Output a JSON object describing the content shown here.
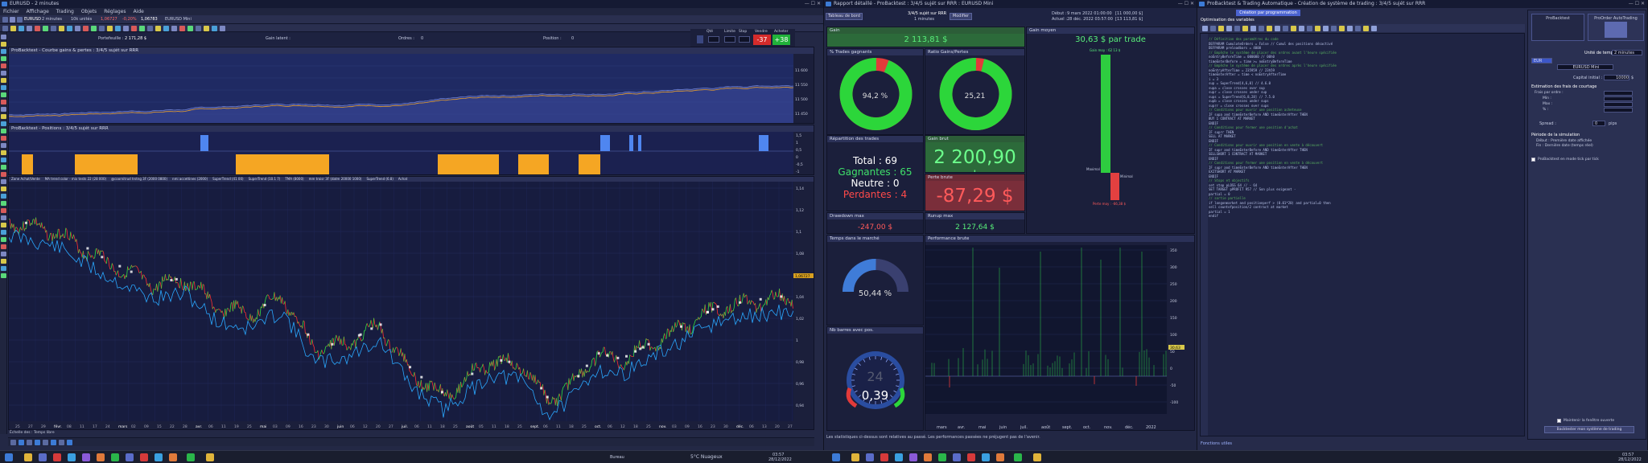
{
  "left_window": {
    "title": "EURUSD - 2 minutes",
    "menu": [
      "Fichier",
      "Affichage",
      "Trading",
      "Objets",
      "Réglages",
      "Aide"
    ],
    "toolbar_instrument": "EURUSD",
    "toolbar_timeframe": "2 minutes",
    "toolbar_units": "10k unités",
    "toolbar_quote": "1,06727",
    "toolbar_change": "-0,20%",
    "toolbar_price": "1,06783",
    "toolbar_instr2": "EURUSD Mini",
    "stats": {
      "portfolio_label": "Portefeuille :",
      "portfolio": "2 171,28 $",
      "gain_label": "Gain latent :",
      "orders_label": "Ordres :",
      "orders": "0",
      "position_label": "Position :",
      "position": "0"
    },
    "sell_label": "Vendre",
    "buy_label": "Acheter",
    "sell_value": "-37",
    "buy_value": "+38",
    "qty_label": "Qté",
    "limit_label": "Limite",
    "stop_label": "Stop",
    "equity_panel_title": "ProBacktest - Courbe gains & pertes : 3/4/5 sujét sur RRR",
    "positions_panel_title": "ProBacktest - Positions : 3/4/5 sujét sur RRR",
    "price_panel_title": "EURUSD Prix",
    "indicator_legend": [
      "Zone Achat/Vente",
      "MA trend color - mix tests 22 (28 000)",
      "@coornitrud trstng 3F (2000 0800)",
      "nmi accettines (2000)",
      "SuperTrend (41 00)",
      "SuperTrend (10.1 7)",
      "TMA (8000)",
      "mm troisr 3F (datm 20000 1000)",
      "SuperTrend (6.8)",
      "Achat"
    ],
    "equity_yaxis": [
      "11 600",
      "11 550",
      "11 500",
      "11 450"
    ],
    "position_yaxis": [
      "1,5",
      "1",
      "0,5",
      "0",
      "-0,5",
      "-1"
    ],
    "price_yaxis": [
      "1,14",
      "1,12",
      "1,1",
      "1,08",
      "1,06",
      "1,04",
      "1,02",
      "1",
      "0,98",
      "0,96",
      "0,94"
    ],
    "current_price_tag": "1,06727",
    "xaxis": [
      "25",
      "27",
      "29",
      "févr.",
      "08",
      "11",
      "17",
      "24",
      "mars",
      "02",
      "09",
      "15",
      "22",
      "28",
      "avr.",
      "06",
      "11",
      "19",
      "25",
      "mai",
      "03",
      "09",
      "16",
      "23",
      "30",
      "juin",
      "06",
      "12",
      "20",
      "27",
      "juil.",
      "06",
      "11",
      "18",
      "25",
      "août",
      "05",
      "11",
      "18",
      "25",
      "sept.",
      "06",
      "11",
      "18",
      "25",
      "oct.",
      "06",
      "12",
      "18",
      "25",
      "nov.",
      "03",
      "09",
      "16",
      "23",
      "30",
      "déc.",
      "06",
      "13",
      "20",
      "27"
    ],
    "footer": "Échelle des : Temps libre"
  },
  "report_window": {
    "title": "Rapport détaillé - ProBacktest : 3/4/5 sujét sur RRR : EURUSD Mini",
    "tabs": [
      "Tableau de bord",
      "Modifier"
    ],
    "system_name": "3/4/5 sujét sur RRR",
    "timeframe": "1 minutes",
    "debut_label": "Début :",
    "debut": "9 mars 2022 01:00:00",
    "debut_capital": "[11 000,00 $]",
    "actuel_label": "Actuel :",
    "actuel": "28 déc. 2022 03:57:00",
    "actuel_capital": "[13 113,81 $]",
    "gain": {
      "title": "Gain",
      "value": "2 113,81 $"
    },
    "gain_moyen": {
      "title": "Gain moyen",
      "value": "30,63 $ par trade",
      "gain_label": "Gain moy : 62 13 $",
      "loss_label": "Perte moy : -66,38 $",
      "max_label": "Maximal",
      "min_label": "Minimal"
    },
    "pct_gagnants": {
      "title": "% Trades gagnants",
      "value": "94,2 %",
      "pct": 94.2
    },
    "ratio": {
      "title": "Ratio Gains/Pertes",
      "value": "25,21",
      "pct": 96.2
    },
    "repartition": {
      "title": "Répartition des trades",
      "total_label": "Total :",
      "total": "69",
      "gagnantes_label": "Gagnantes :",
      "gagnantes": "65",
      "neutre_label": "Neutre :",
      "neutre": "0",
      "perdantes_label": "Perdantes :",
      "perdantes": "4"
    },
    "gain_brut": {
      "title": "Gain brut",
      "value": "2 200,90 $"
    },
    "perte_brute": {
      "title": "Perte brute",
      "value": "-87,29 $"
    },
    "drawdown": {
      "title": "Drawdown max",
      "value": "-247,00 $"
    },
    "runup": {
      "title": "Runup max",
      "value": "2 127,64 $"
    },
    "temps_marche": {
      "title": "Temps dans le marché",
      "value": "50,44 %",
      "pct": 50.44
    },
    "barres": {
      "title": "Nb barres avec pos.",
      "value": "0,39",
      "small": "24"
    },
    "perf": {
      "title": "Performance brute",
      "yaxis": [
        "350",
        "300",
        "250",
        "200",
        "150",
        "100",
        "50",
        "0",
        "-50",
        "-100"
      ],
      "xaxis": [
        "mars",
        "avr.",
        "mai",
        "juin",
        "juil.",
        "août",
        "sept.",
        "oct.",
        "nov.",
        "déc.",
        "2022"
      ],
      "tag": "30,63"
    },
    "footer": "Les statistiques ci-dessus sont relatives au passé. Les performances passées ne préjugent pas de l'avenir."
  },
  "editor_window": {
    "title": "ProBacktest & Trading Automatique - Création de système de trading : 3/4/5 sujét sur RRR",
    "tab": "Création par programmation",
    "vars_label": "Optimisation des variables",
    "footer_link": "Fonctions utiles",
    "code": [
      "// Définition des paramètres du code",
      "DEFPARAM CumulateOrders = False // Cumul des positions désactivé",
      "DEFPARAM preloadbars = 4000",
      "",
      "// Empêche le système de placer des ordres avant l'heure spécifiée",
      "noEntryBeforeTime = 000000 // 00h0",
      "timeEnterBefore = time >= noEntryBeforeTime",
      "// Empêche le système de placer des ordres après l'heure spécifiée",
      "noEntryAfterTime = 235959 // 23h59",
      "timeEnterAfter = time < noEntryAfterTime",
      "",
      "i = 3",
      "",
      "sup = SuperTrend[4,6,0] // 4.6.0",
      "supa = close crosses over sup",
      "supr = close crosses under sup",
      "",
      "sups = SuperTrend[6,8,28] // 7.5.0",
      "supb = close crosses under sups",
      "suprr = close crosses over sups",
      "",
      "",
      "// Conditions pour ouvrir une position acheteuse",
      "IF supa and timeEnterBefore AND timeEnterAfter THEN",
      "  BUY 1 CONTRACT AT MARKET",
      "ENDIF",
      "",
      "// Conditions pour fermer une position d'achat",
      "IF suprr THEN",
      "  SELL AT MARKET",
      "ENDIF",
      "",
      "// Conditions pour ouvrir une position en vente à découvert",
      "IF supr and timeEnterBefore AND timeEnterAfter THEN",
      "  SELLSHORT 1 CONTRACT AT MARKET",
      "ENDIF",
      "",
      "// Conditions pour fermer une position en vente à découvert",
      "IF supr and timeEnterBefore AND timeEnterAfter THEN",
      "  EXITSHORT AT MARKET",
      "ENDIF",
      "",
      "",
      "// Stops et objectifs",
      "set stop pLOSS 64 // - 64",
      "SET TARGET pPROFIT 957 // Son plus exigeant -",
      "partial = 0",
      "",
      "// sortie partielle",
      "if longonmarket and positionperf > (0.01*20) and partial=0 then",
      "  sell countofposition/2 contract at market",
      "  partial = 1",
      "endif"
    ]
  },
  "settings_panel": {
    "tab1": "ProBacktest",
    "tab2": "ProOrder AutoTrading",
    "unit_label": "Unité de temps :",
    "unit_value": "2 minutes",
    "instrument": "EURUSD Mini",
    "capital_label": "Capital initial :",
    "capital_value": "10000",
    "currency": "$",
    "frais_title": "Estimation des frais de courtage",
    "frais_items": [
      "Frais par ordre :",
      "Min :",
      "Max :",
      "% :"
    ],
    "spread_label": "Spread :",
    "spread_value": "0",
    "spread_unit": "pips",
    "periode_title": "Période de la simulation",
    "periode_opts": [
      "Début :  Première date affichée",
      "Fin :  Dernière date (temps réel)"
    ],
    "realtime_label": "ProBacktest en mode tick par tick",
    "keep_label": "Maintenir la fenêtre ouverte",
    "run_button": "Backtester mon système de trading"
  },
  "taskbar": {
    "weather": "5°C  Nuageux",
    "lang": "Bureau",
    "time": "03:57",
    "date": "28/12/2022"
  }
}
